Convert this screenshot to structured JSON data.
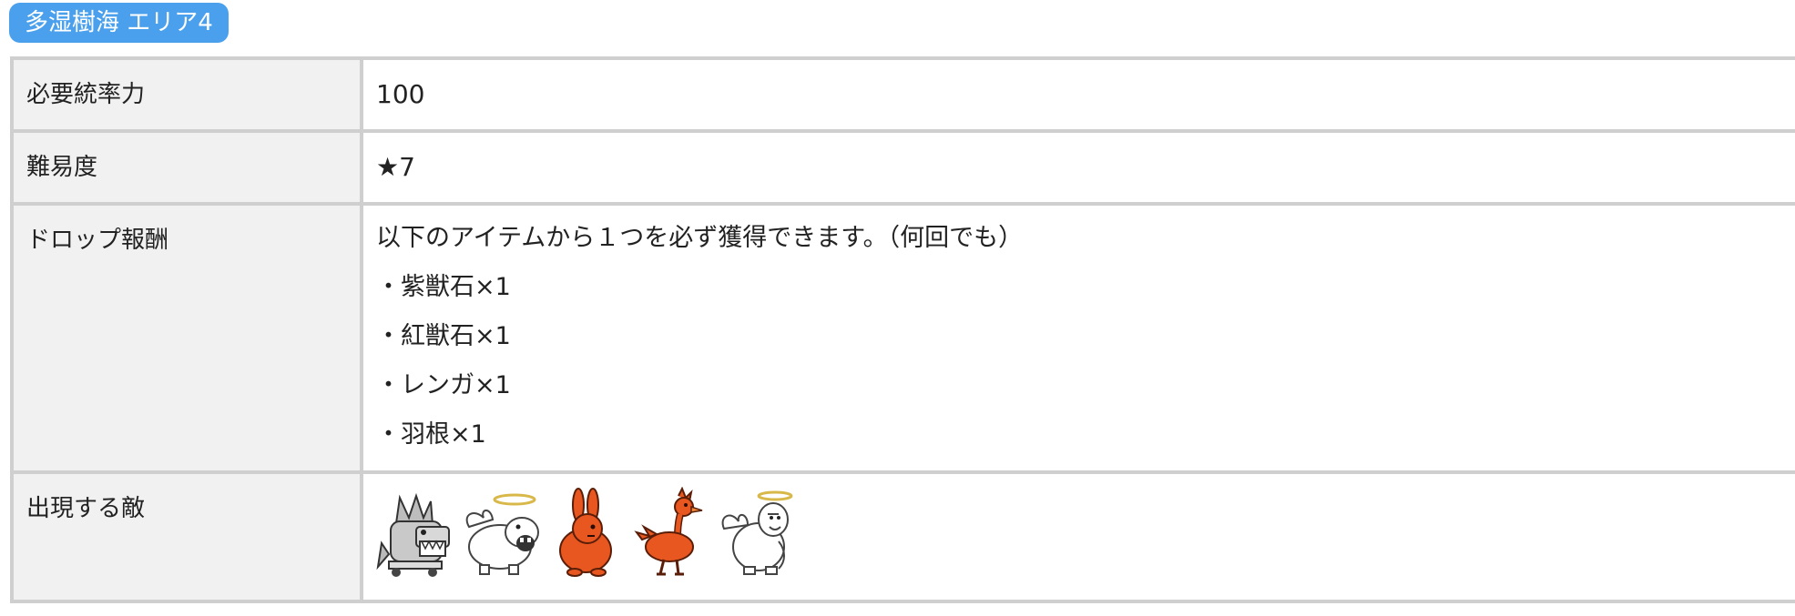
{
  "area_title": "多湿樹海 エリア4",
  "rows": {
    "cost": {
      "label": "必要統率力",
      "value": "100"
    },
    "difficulty": {
      "label": "難易度",
      "value": "★7"
    },
    "drops": {
      "label": "ドロップ報酬",
      "intro": "以下のアイテムから１つを必ず獲得できます。（何回でも）",
      "items": [
        "・紫獣石×1",
        "・紅獣石×1",
        "・レンガ×1",
        "・羽根×1"
      ]
    },
    "enemies": {
      "label": "出現する敵",
      "icons": [
        "wolf-enemy-icon",
        "winged-hippo-enemy-icon",
        "red-rabbit-enemy-icon",
        "red-ostrich-enemy-icon",
        "winged-gorilla-enemy-icon"
      ]
    }
  },
  "colors": {
    "tag_bg": "#4aa0ec",
    "label_bg": "#f1f1f1",
    "border": "#cfcfcf",
    "enemy_red": "#e8571f"
  }
}
